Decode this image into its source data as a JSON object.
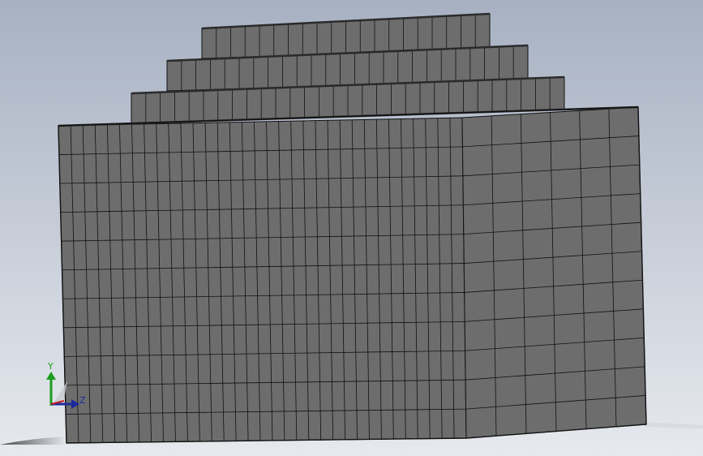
{
  "viewport": {
    "background_top": "#a7b1c2",
    "background_bottom": "#e6e9ee"
  },
  "model": {
    "face_color": "#6d6d6d",
    "edge_color": "#111111",
    "top_edge_color": "#2a2a2a",
    "shadow_color": "#4a4a4a"
  },
  "triad": {
    "y_label": "Y",
    "z_label": "Z",
    "y_color": "#1e9b1e",
    "z_color": "#1d2a9c",
    "x_color": "#c42020"
  }
}
